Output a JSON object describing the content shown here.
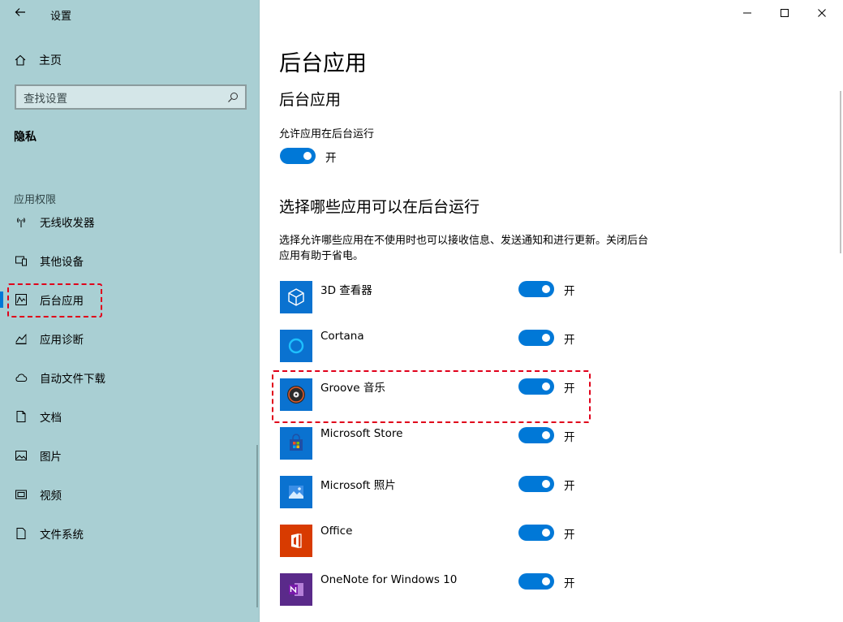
{
  "window": {
    "title": "设置"
  },
  "sidebar": {
    "home_label": "主页",
    "search_placeholder": "查找设置",
    "section_title": "隐私",
    "group_label": "应用权限",
    "items": [
      {
        "label": "无线收发器",
        "icon": "wireless-icon"
      },
      {
        "label": "其他设备",
        "icon": "devices-icon"
      },
      {
        "label": "后台应用",
        "icon": "background-apps-icon",
        "active": true
      },
      {
        "label": "应用诊断",
        "icon": "diagnostics-icon"
      },
      {
        "label": "自动文件下载",
        "icon": "cloud-icon"
      },
      {
        "label": "文档",
        "icon": "document-icon"
      },
      {
        "label": "图片",
        "icon": "picture-icon"
      },
      {
        "label": "视频",
        "icon": "video-icon"
      },
      {
        "label": "文件系统",
        "icon": "file-system-icon"
      }
    ]
  },
  "main": {
    "page_title": "后台应用",
    "section_title": "后台应用",
    "allow_label": "允许应用在后台运行",
    "allow_state": "开",
    "choose_title": "选择哪些应用可以在后台运行",
    "description": "选择允许哪些应用在不使用时也可以接收信息、发送通知和进行更新。关闭后台应用有助于省电。",
    "apps": [
      {
        "name": "3D 查看器",
        "state": "开",
        "icon": "3d-viewer-icon"
      },
      {
        "name": "Cortana",
        "state": "开",
        "icon": "cortana-icon"
      },
      {
        "name": "Groove 音乐",
        "state": "开",
        "icon": "groove-music-icon"
      },
      {
        "name": "Microsoft Store",
        "state": "开",
        "icon": "store-icon"
      },
      {
        "name": "Microsoft 照片",
        "state": "开",
        "icon": "photos-icon"
      },
      {
        "name": "Office",
        "state": "开",
        "icon": "office-icon"
      },
      {
        "name": "OneNote for Windows 10",
        "state": "开",
        "icon": "onenote-icon"
      }
    ]
  },
  "colors": {
    "accent": "#0078d7",
    "sidebar_bg": "#a9cfd3",
    "highlight": "#e0001a"
  }
}
